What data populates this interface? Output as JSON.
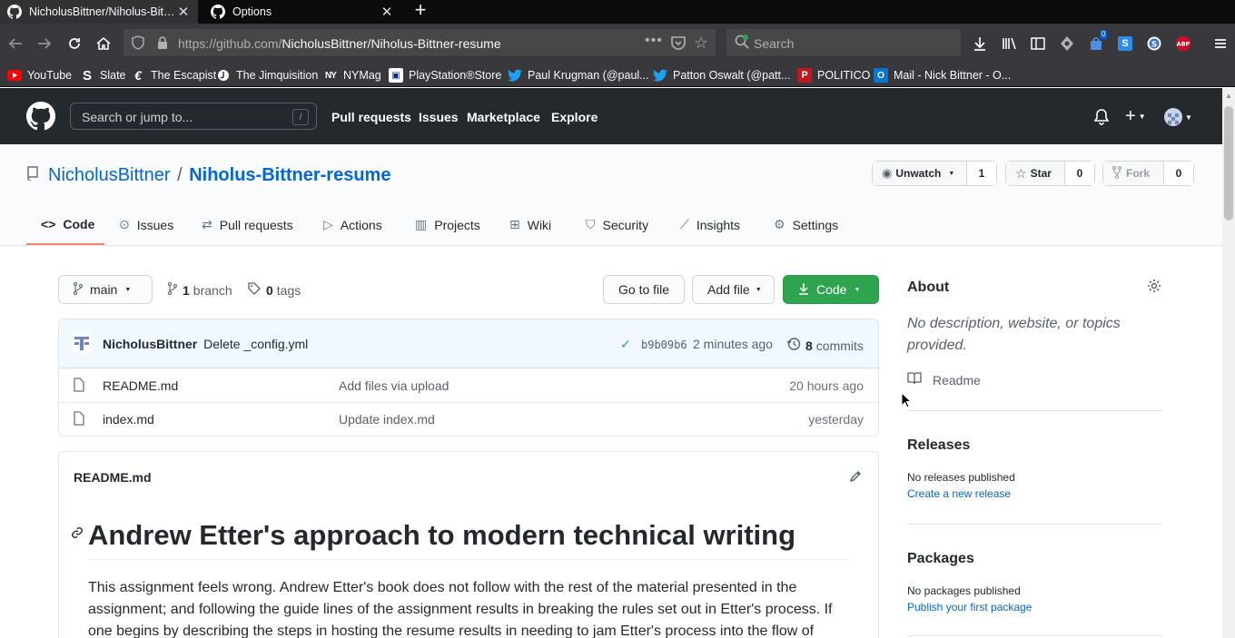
{
  "browser": {
    "tabs": [
      {
        "label": "NicholusBittner/Niholus-Bittner-resume"
      },
      {
        "label": "Options"
      }
    ],
    "url_host": "https://github.com/",
    "url_path": "NicholusBittner/Niholus-Bittner-resume",
    "search_placeholder": "Search",
    "notification_count": "0",
    "bookmarks": [
      {
        "label": "YouTube",
        "icon": "youtube-icon",
        "color": "#ff0000"
      },
      {
        "label": "Slate",
        "icon": "slate-icon",
        "color": "#ffffff"
      },
      {
        "label": "The Escapist",
        "icon": "escapist-icon",
        "color": "#ffffff"
      },
      {
        "label": "The Jimquisition",
        "icon": "jimquisition-icon",
        "color": "#ffffff"
      },
      {
        "label": "NYMag",
        "icon": "nymag-icon",
        "color": "#ffffff"
      },
      {
        "label": "PlayStation®Store",
        "icon": "playstation-icon",
        "color": "#ffffff"
      },
      {
        "label": "Paul Krugman (@paul...",
        "icon": "twitter-icon",
        "color": "#1da1f2"
      },
      {
        "label": "Patton Oswalt (@patt...",
        "icon": "twitter-icon",
        "color": "#1da1f2"
      },
      {
        "label": "POLITICO",
        "icon": "politico-icon",
        "color": "#c4161c"
      },
      {
        "label": "Mail - Nick Bittner - O...",
        "icon": "outlook-icon",
        "color": "#0078d4"
      }
    ]
  },
  "github": {
    "search_placeholder": "Search or jump to...",
    "search_key": "/",
    "nav": [
      "Pull requests",
      "Issues",
      "Marketplace",
      "Explore"
    ],
    "owner": "NicholusBittner",
    "separator": "/",
    "repo": "Niholus-Bittner-resume",
    "watch": {
      "label": "Unwatch",
      "count": "1"
    },
    "star": {
      "label": "Star",
      "count": "0"
    },
    "fork": {
      "label": "Fork",
      "count": "0"
    },
    "tabs": [
      "Code",
      "Issues",
      "Pull requests",
      "Actions",
      "Projects",
      "Wiki",
      "Security",
      "Insights",
      "Settings"
    ],
    "branch_button": "main",
    "branch_count": "1",
    "branch_label": "branch",
    "tag_count": "0",
    "tag_label": "tags",
    "go_to_file": "Go to file",
    "add_file": "Add file",
    "code_button": "Code",
    "commit": {
      "author": "NicholusBittner",
      "message": "Delete _config.yml",
      "sha": "b9b09b6",
      "time": "2 minutes ago",
      "count": "8",
      "count_label": "commits"
    },
    "files": [
      {
        "name": "README.md",
        "message": "Add files via upload",
        "time": "20 hours ago"
      },
      {
        "name": "index.md",
        "message": "Update index.md",
        "time": "yesterday"
      }
    ],
    "readme": {
      "filename": "README.md",
      "heading": "Andrew Etter's approach to modern technical writing",
      "body": "This assignment feels wrong. Andrew Etter's book does not follow with the rest of the material presented in the assignment; and following the guide lines of the assignment results in breaking the rules set out in Etter's process. If one begins by describing the steps in hosting the resume results in needing to jam Etter's process into the flow of"
    },
    "about": {
      "title": "About",
      "description": "No description, website, or topics provided.",
      "readme_link": "Readme"
    },
    "releases": {
      "title": "Releases",
      "status": "No releases published",
      "link": "Create a new release"
    },
    "packages": {
      "title": "Packages",
      "status": "No packages published",
      "link": "Publish your first package"
    }
  }
}
